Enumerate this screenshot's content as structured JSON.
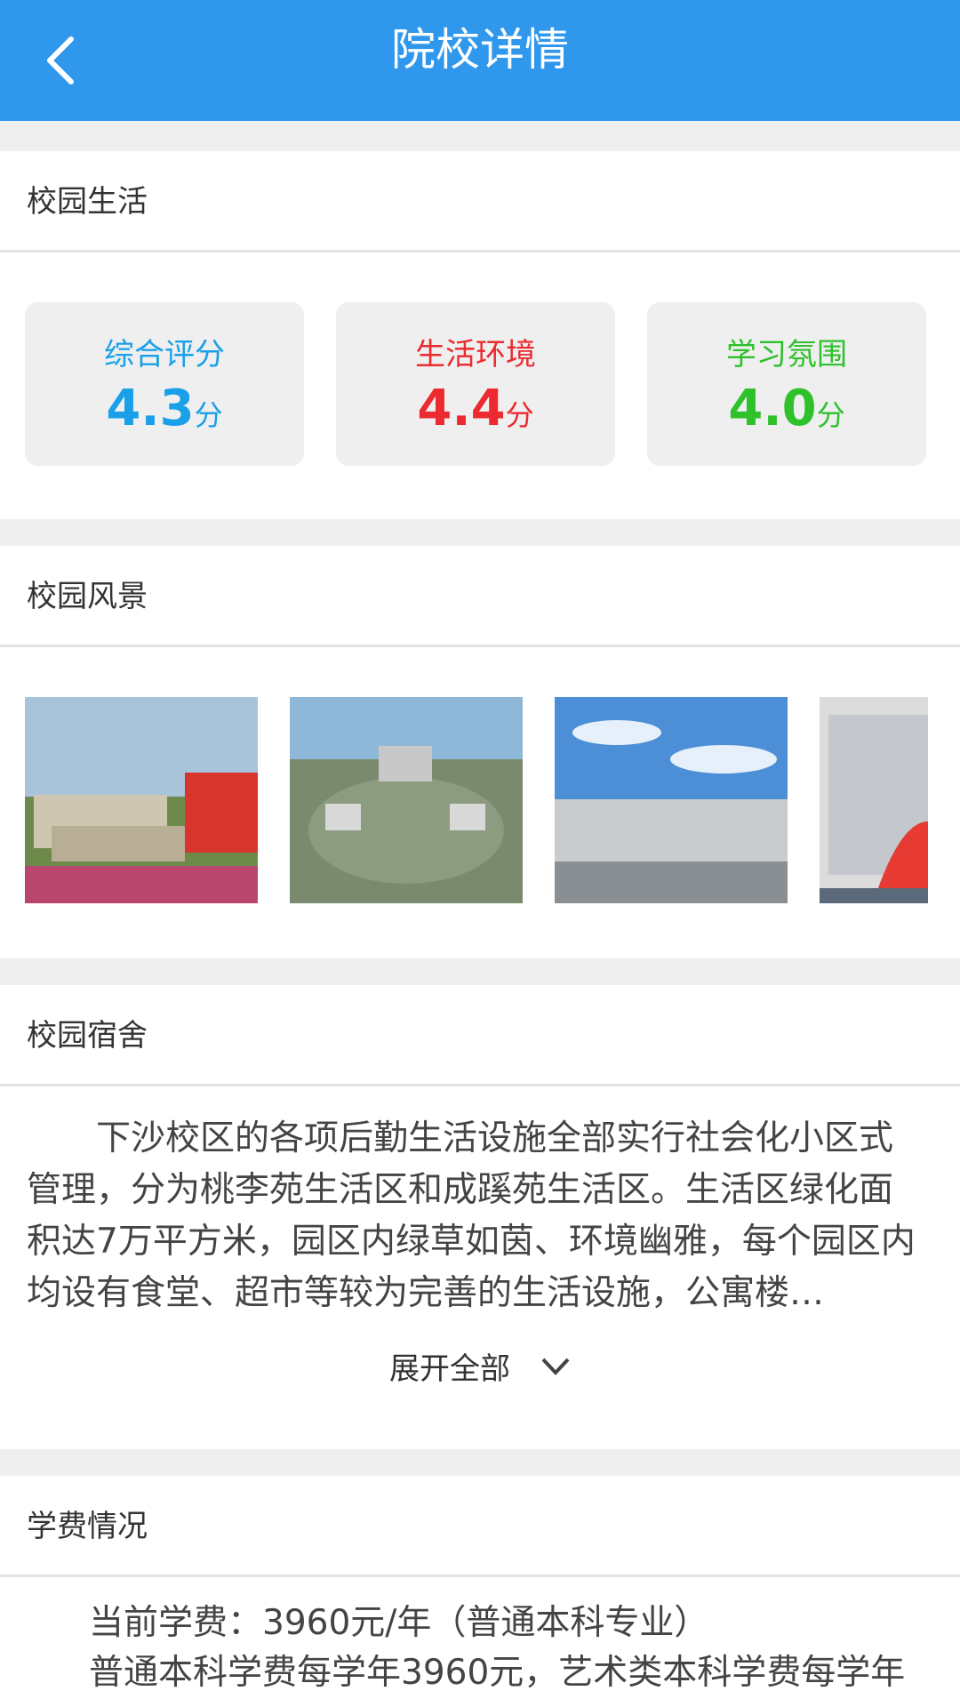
{
  "header": {
    "title": "院校详情",
    "back_icon": "chevron-left-icon"
  },
  "campus_life": {
    "title": "校园生活",
    "scores": [
      {
        "label": "综合评分",
        "value": "4.3",
        "unit": "分",
        "color": "#1aa0e8"
      },
      {
        "label": "生活环境",
        "value": "4.4",
        "unit": "分",
        "color": "#ec2a2f"
      },
      {
        "label": "学习氛围",
        "value": "4.0",
        "unit": "分",
        "color": "#2ec12a"
      }
    ]
  },
  "scenery": {
    "title": "校园风景"
  },
  "dorm": {
    "title": "校园宿舍",
    "text": "下沙校区的各项后勤生活设施全部实行社会化小区式管理，分为桃李苑生活区和成蹊苑生活区。生活区绿化面积达7万平方米，园区内绿草如茵、环境幽雅，每个园区内均设有食堂、超市等较为完善的生活设施，公寓楼…",
    "expand_label": "展开全部"
  },
  "tuition": {
    "title": "学费情况",
    "line1": "当前学费：3960元/年（普通本科专业）",
    "line2": "普通本科学费每学年3960元，艺术类本科学费每学年"
  }
}
